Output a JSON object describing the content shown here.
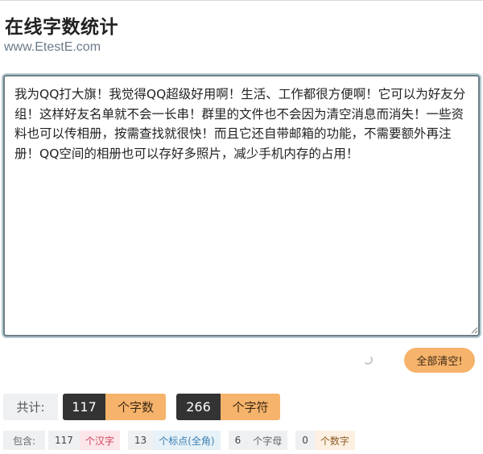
{
  "header": {
    "title": "在线字数统计",
    "url": "www.EtestE.com"
  },
  "editor": {
    "text": "我为QQ打大旗！我觉得QQ超级好用啊！生活、工作都很方便啊！它可以为好友分组！这样好友名单就不会一长串！群里的文件也不会因为清空消息而消失！一些资料也可以传相册，按需查找就很快！而且它还自带邮箱的功能，不需要额外再注册！QQ空间的相册也可以存好多照片，减少手机内存的占用！"
  },
  "actions": {
    "clear_label": "全部清空!"
  },
  "totals": {
    "label": "共计:",
    "words": "117",
    "words_unit": "个字数",
    "chars": "266",
    "chars_unit": "个字符"
  },
  "details": {
    "label": "包含:",
    "han_count": "117",
    "han_unit": "个汉字",
    "punct_count": "13",
    "punct_unit": "个标点(全角)",
    "letter_count": "6",
    "letter_unit": "个字母",
    "digit_count": "0",
    "digit_unit": "个数字"
  },
  "colors": {
    "accent": "#f6b36b",
    "dark": "#333333",
    "textarea_border": "#6c7f86"
  }
}
